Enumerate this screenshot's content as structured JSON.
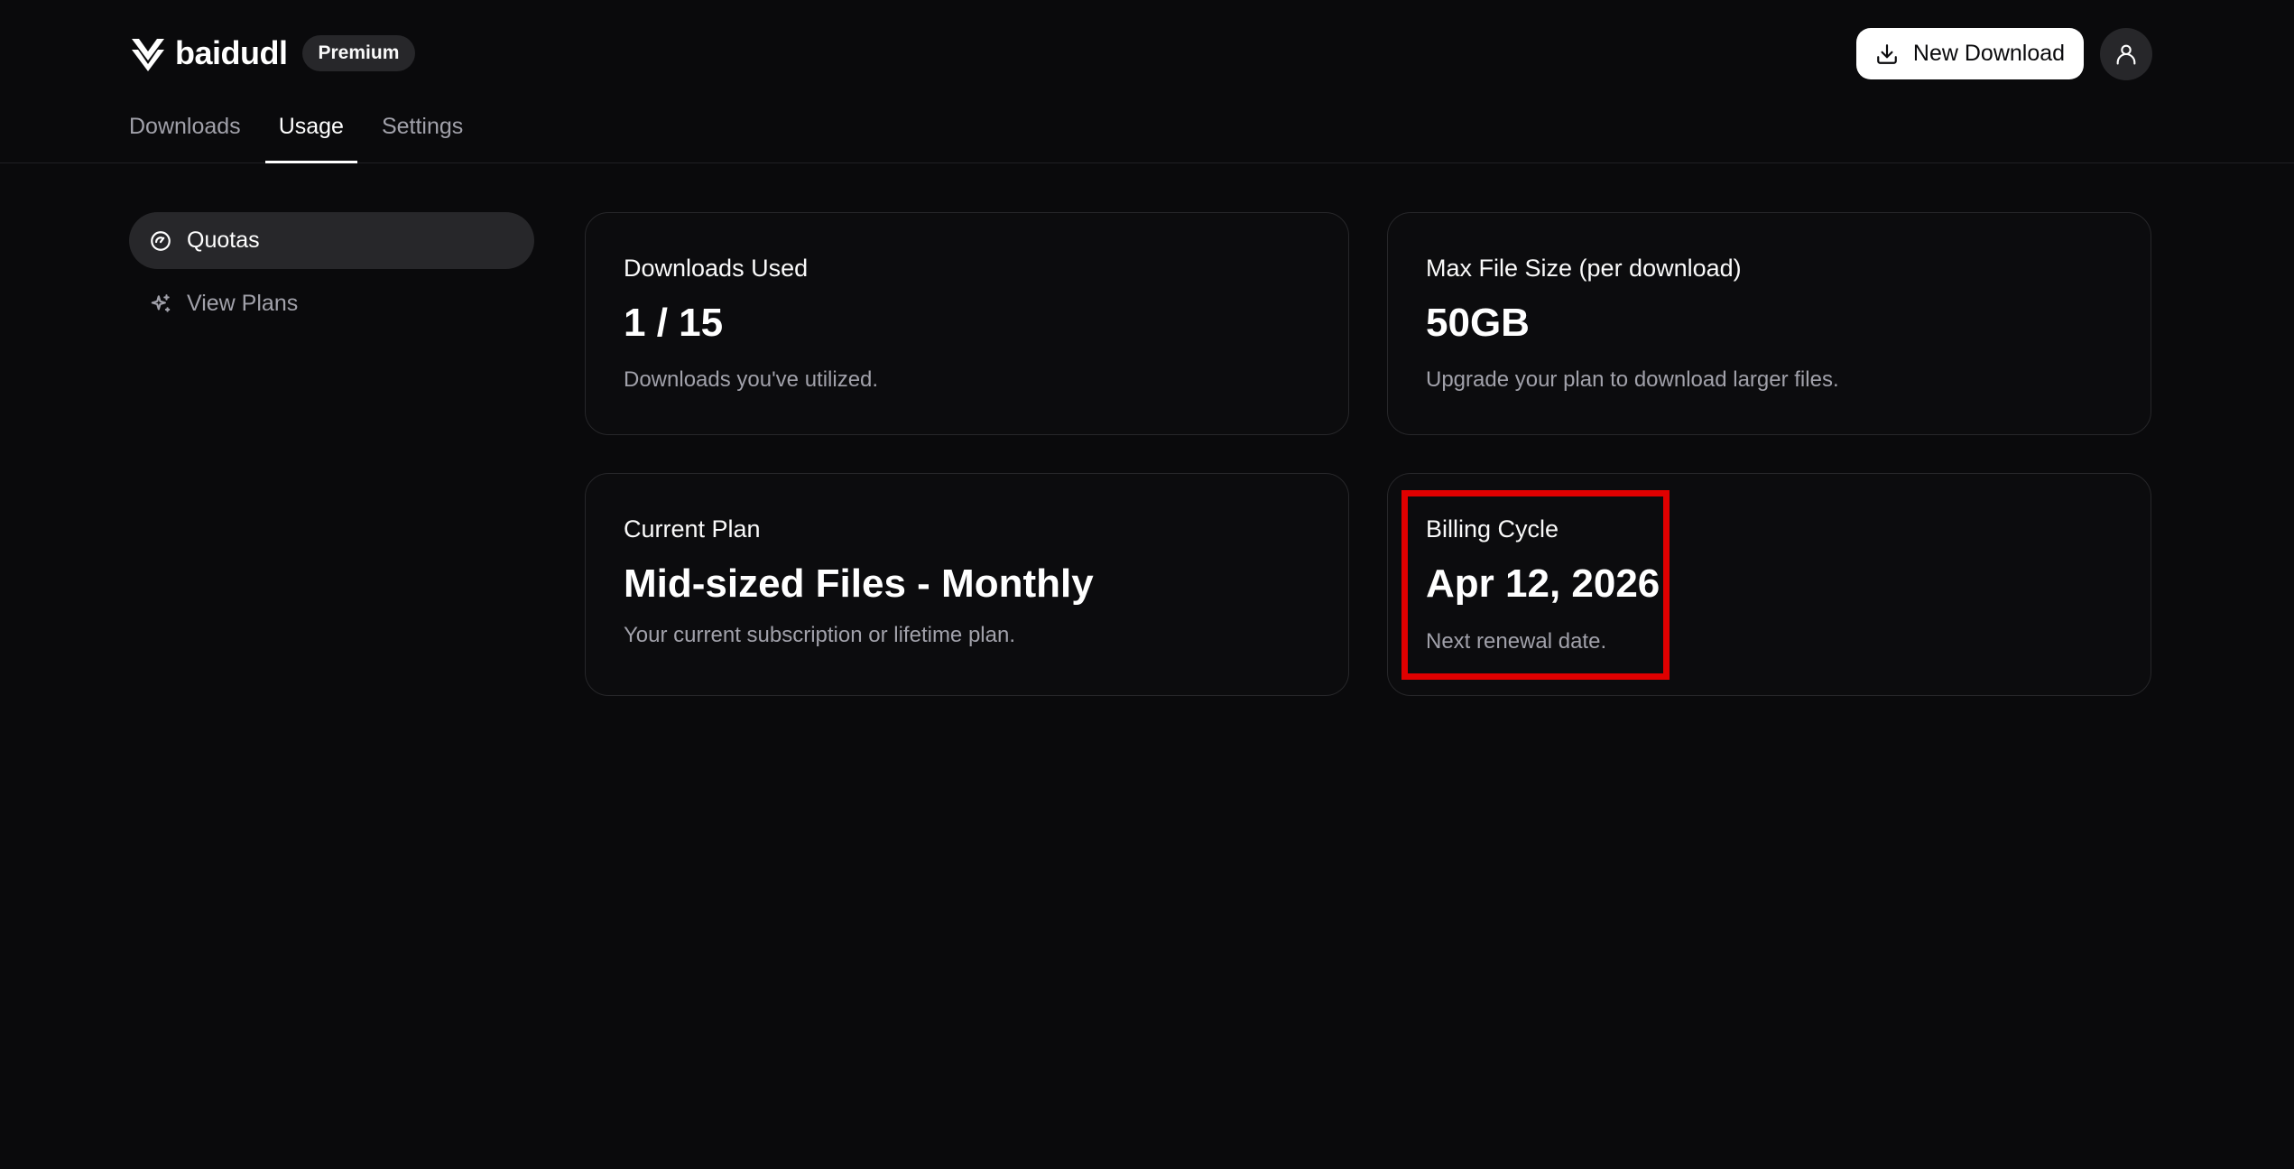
{
  "app": {
    "name": "baidudl",
    "badge": "Premium"
  },
  "header": {
    "new_download_label": "New Download"
  },
  "tabs": [
    {
      "label": "Downloads",
      "active": false
    },
    {
      "label": "Usage",
      "active": true
    },
    {
      "label": "Settings",
      "active": false
    }
  ],
  "sidebar": {
    "items": [
      {
        "label": "Quotas",
        "icon": "gauge-icon",
        "active": true
      },
      {
        "label": "View Plans",
        "icon": "sparkles-icon",
        "active": false
      }
    ]
  },
  "cards": {
    "downloads_used": {
      "title": "Downloads Used",
      "value": "1 / 15",
      "description": "Downloads you've utilized."
    },
    "max_file_size": {
      "title": "Max File Size (per download)",
      "value": "50GB",
      "description": "Upgrade your plan to download larger files."
    },
    "current_plan": {
      "title": "Current Plan",
      "value": "Mid-sized Files - Monthly",
      "description": "Your current subscription or lifetime plan."
    },
    "billing_cycle": {
      "title": "Billing Cycle",
      "value": "Apr 12, 2026",
      "description": "Next renewal date."
    }
  },
  "colors": {
    "background": "#0a0a0c",
    "card_border": "#27272a",
    "highlight": "#e00000"
  }
}
